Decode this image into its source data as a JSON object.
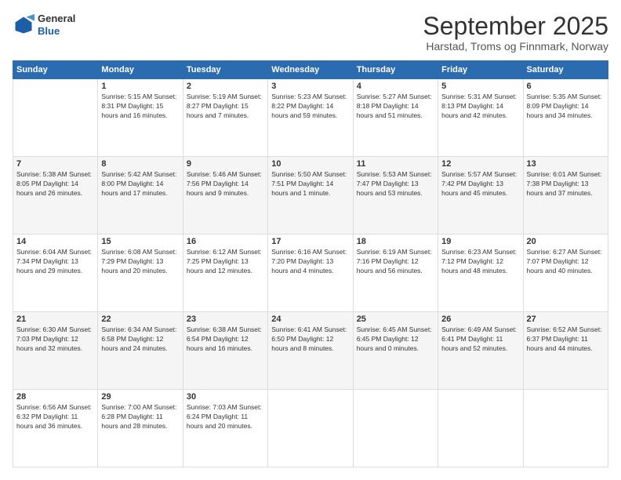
{
  "header": {
    "logo_general": "General",
    "logo_blue": "Blue",
    "month_title": "September 2025",
    "subtitle": "Harstad, Troms og Finnmark, Norway"
  },
  "weekdays": [
    "Sunday",
    "Monday",
    "Tuesday",
    "Wednesday",
    "Thursday",
    "Friday",
    "Saturday"
  ],
  "rows": [
    [
      {
        "day": "",
        "info": ""
      },
      {
        "day": "1",
        "info": "Sunrise: 5:15 AM\nSunset: 8:31 PM\nDaylight: 15 hours\nand 16 minutes."
      },
      {
        "day": "2",
        "info": "Sunrise: 5:19 AM\nSunset: 8:27 PM\nDaylight: 15 hours\nand 7 minutes."
      },
      {
        "day": "3",
        "info": "Sunrise: 5:23 AM\nSunset: 8:22 PM\nDaylight: 14 hours\nand 59 minutes."
      },
      {
        "day": "4",
        "info": "Sunrise: 5:27 AM\nSunset: 8:18 PM\nDaylight: 14 hours\nand 51 minutes."
      },
      {
        "day": "5",
        "info": "Sunrise: 5:31 AM\nSunset: 8:13 PM\nDaylight: 14 hours\nand 42 minutes."
      },
      {
        "day": "6",
        "info": "Sunrise: 5:35 AM\nSunset: 8:09 PM\nDaylight: 14 hours\nand 34 minutes."
      }
    ],
    [
      {
        "day": "7",
        "info": "Sunrise: 5:38 AM\nSunset: 8:05 PM\nDaylight: 14 hours\nand 26 minutes."
      },
      {
        "day": "8",
        "info": "Sunrise: 5:42 AM\nSunset: 8:00 PM\nDaylight: 14 hours\nand 17 minutes."
      },
      {
        "day": "9",
        "info": "Sunrise: 5:46 AM\nSunset: 7:56 PM\nDaylight: 14 hours\nand 9 minutes."
      },
      {
        "day": "10",
        "info": "Sunrise: 5:50 AM\nSunset: 7:51 PM\nDaylight: 14 hours\nand 1 minute."
      },
      {
        "day": "11",
        "info": "Sunrise: 5:53 AM\nSunset: 7:47 PM\nDaylight: 13 hours\nand 53 minutes."
      },
      {
        "day": "12",
        "info": "Sunrise: 5:57 AM\nSunset: 7:42 PM\nDaylight: 13 hours\nand 45 minutes."
      },
      {
        "day": "13",
        "info": "Sunrise: 6:01 AM\nSunset: 7:38 PM\nDaylight: 13 hours\nand 37 minutes."
      }
    ],
    [
      {
        "day": "14",
        "info": "Sunrise: 6:04 AM\nSunset: 7:34 PM\nDaylight: 13 hours\nand 29 minutes."
      },
      {
        "day": "15",
        "info": "Sunrise: 6:08 AM\nSunset: 7:29 PM\nDaylight: 13 hours\nand 20 minutes."
      },
      {
        "day": "16",
        "info": "Sunrise: 6:12 AM\nSunset: 7:25 PM\nDaylight: 13 hours\nand 12 minutes."
      },
      {
        "day": "17",
        "info": "Sunrise: 6:16 AM\nSunset: 7:20 PM\nDaylight: 13 hours\nand 4 minutes."
      },
      {
        "day": "18",
        "info": "Sunrise: 6:19 AM\nSunset: 7:16 PM\nDaylight: 12 hours\nand 56 minutes."
      },
      {
        "day": "19",
        "info": "Sunrise: 6:23 AM\nSunset: 7:12 PM\nDaylight: 12 hours\nand 48 minutes."
      },
      {
        "day": "20",
        "info": "Sunrise: 6:27 AM\nSunset: 7:07 PM\nDaylight: 12 hours\nand 40 minutes."
      }
    ],
    [
      {
        "day": "21",
        "info": "Sunrise: 6:30 AM\nSunset: 7:03 PM\nDaylight: 12 hours\nand 32 minutes."
      },
      {
        "day": "22",
        "info": "Sunrise: 6:34 AM\nSunset: 6:58 PM\nDaylight: 12 hours\nand 24 minutes."
      },
      {
        "day": "23",
        "info": "Sunrise: 6:38 AM\nSunset: 6:54 PM\nDaylight: 12 hours\nand 16 minutes."
      },
      {
        "day": "24",
        "info": "Sunrise: 6:41 AM\nSunset: 6:50 PM\nDaylight: 12 hours\nand 8 minutes."
      },
      {
        "day": "25",
        "info": "Sunrise: 6:45 AM\nSunset: 6:45 PM\nDaylight: 12 hours\nand 0 minutes."
      },
      {
        "day": "26",
        "info": "Sunrise: 6:49 AM\nSunset: 6:41 PM\nDaylight: 11 hours\nand 52 minutes."
      },
      {
        "day": "27",
        "info": "Sunrise: 6:52 AM\nSunset: 6:37 PM\nDaylight: 11 hours\nand 44 minutes."
      }
    ],
    [
      {
        "day": "28",
        "info": "Sunrise: 6:56 AM\nSunset: 6:32 PM\nDaylight: 11 hours\nand 36 minutes."
      },
      {
        "day": "29",
        "info": "Sunrise: 7:00 AM\nSunset: 6:28 PM\nDaylight: 11 hours\nand 28 minutes."
      },
      {
        "day": "30",
        "info": "Sunrise: 7:03 AM\nSunset: 6:24 PM\nDaylight: 11 hours\nand 20 minutes."
      },
      {
        "day": "",
        "info": ""
      },
      {
        "day": "",
        "info": ""
      },
      {
        "day": "",
        "info": ""
      },
      {
        "day": "",
        "info": ""
      }
    ]
  ]
}
